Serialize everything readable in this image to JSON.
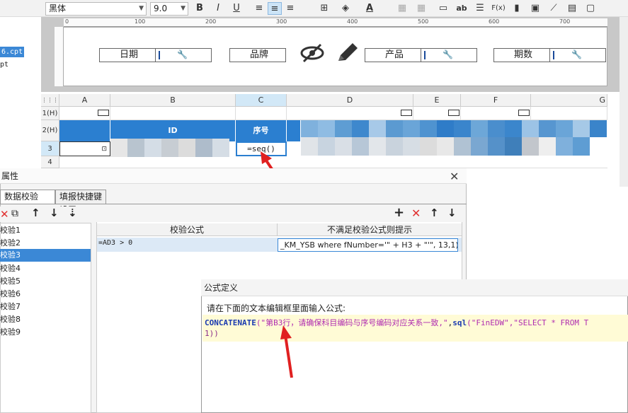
{
  "toolbar": {
    "font_family": "黑体",
    "font_size": "9.0",
    "bold": "B",
    "italic": "I",
    "underline": "U",
    "text_color_letter": "A",
    "ab_label": "ab",
    "fx_label": "F(x)"
  },
  "sidebar": {
    "file_selected": "6.cpt",
    "file_other": "pt"
  },
  "form_bar": {
    "ruler_ticks": [
      "0",
      "100",
      "200",
      "300",
      "400",
      "500",
      "600",
      "700"
    ],
    "fields": [
      {
        "label": "日期"
      },
      {
        "label": "品牌"
      },
      {
        "label": "产品"
      },
      {
        "label": "期数"
      }
    ]
  },
  "sheet": {
    "columns": [
      "A",
      "B",
      "C",
      "D",
      "E",
      "F",
      "G"
    ],
    "rows": [
      "1(H)",
      "2(H)",
      "3",
      "4"
    ],
    "header_id": "ID",
    "header_seq": "序号",
    "cell_c3": "=seq()"
  },
  "property_dialog": {
    "title": "属性",
    "tabs": [
      "数据校验",
      "填报快捷键设置"
    ],
    "validations": [
      "校验1",
      "校验2",
      "校验3",
      "校验4",
      "校验5",
      "校验6",
      "校验7",
      "校验8",
      "校验9"
    ],
    "selected_index": 2,
    "table_headers": [
      "校验公式",
      "不满足校验公式则提示"
    ],
    "row_formula": "=AD3 > 0",
    "row_message": "_KM_YSB where fNumber='\" + H3 + \"'\", 13,1))"
  },
  "formula_dialog": {
    "title": "公式定义",
    "prompt": "请在下面的文本编辑框里面输入公式:",
    "fn_concat": "CONCATENATE",
    "open_paren": "(",
    "str_part": "\"第B3行，请确保科目编码与序号编码对应关系一致,\"",
    "comma": ",",
    "fn_sql": "sql",
    "sql_args": "(\"FinEDW\",\"SELECT * FROM T",
    "line2": "1))"
  }
}
